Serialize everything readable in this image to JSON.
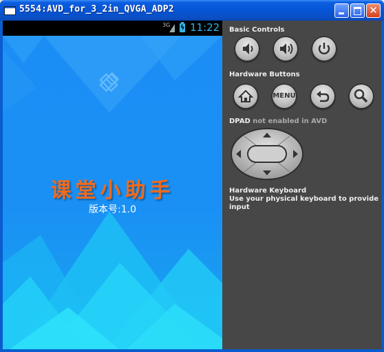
{
  "window": {
    "title": "5554:AVD_for_3_2in_QVGA_ADP2",
    "close_glyph": "✕"
  },
  "status_bar": {
    "network": "3G",
    "time": "11:22",
    "battery_glyph": "ϟ"
  },
  "app": {
    "title": "课堂小助手",
    "version": "版本号:1.0"
  },
  "controls": {
    "basic_controls_label": "Basic Controls",
    "hardware_buttons_label": "Hardware Buttons",
    "dpad_label": "DPAD",
    "dpad_note": "not enabled in AVD",
    "menu_label": "MENU",
    "keyboard_label": "Hardware Keyboard",
    "keyboard_note": "Use your physical keyboard to provide input"
  },
  "colors": {
    "screen_bg": "#1a8cf3",
    "title_accent": "#f26a1b",
    "clock": "#33b5e5",
    "panel_bg": "#474747"
  }
}
